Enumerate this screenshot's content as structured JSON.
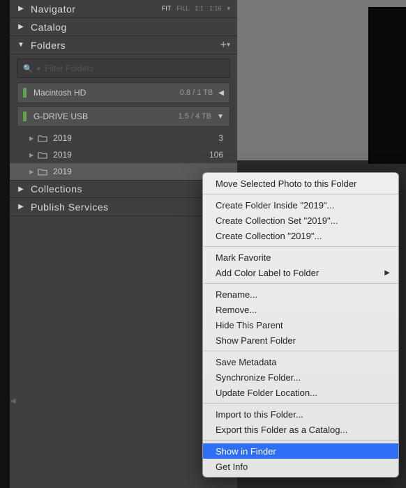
{
  "panels": {
    "navigator": {
      "label": "Navigator",
      "zoom": {
        "fit": "FIT",
        "fill": "FILL",
        "one": "1:1",
        "custom": "1:16"
      }
    },
    "catalog": {
      "label": "Catalog"
    },
    "folders": {
      "label": "Folders"
    },
    "collections": {
      "label": "Collections"
    },
    "publish": {
      "label": "Publish Services"
    }
  },
  "filter": {
    "placeholder": "Filter Folders"
  },
  "volumes": [
    {
      "name": "Macintosh HD",
      "usage": "0.8 / 1 TB",
      "expanded": false
    },
    {
      "name": "G-DRIVE USB",
      "usage": "1.5 / 4 TB",
      "expanded": true
    }
  ],
  "folder_items": [
    {
      "name": "2019",
      "count": "3",
      "selected": false
    },
    {
      "name": "2019",
      "count": "106",
      "selected": false
    },
    {
      "name": "2019",
      "count": "",
      "selected": true
    }
  ],
  "menu": {
    "groups": [
      [
        "Move Selected Photo to this Folder"
      ],
      [
        "Create Folder Inside \"2019\"...",
        "Create Collection Set \"2019\"...",
        "Create Collection \"2019\"..."
      ],
      [
        "Mark Favorite",
        "Add Color Label to Folder"
      ],
      [
        "Rename...",
        "Remove...",
        "Hide This Parent",
        "Show Parent Folder"
      ],
      [
        "Save Metadata",
        "Synchronize Folder...",
        "Update Folder Location..."
      ],
      [
        "Import to this Folder...",
        "Export this Folder as a Catalog..."
      ],
      [
        "Show in Finder",
        "Get Info"
      ]
    ],
    "submenu_items": [
      "Add Color Label to Folder"
    ],
    "highlighted": "Show in Finder"
  }
}
